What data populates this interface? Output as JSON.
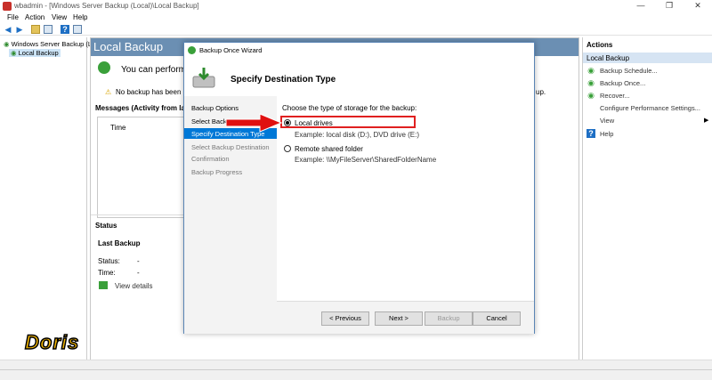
{
  "window": {
    "title": "wbadmin - [Windows Server Backup (Local)\\Local Backup]",
    "min": "—",
    "max": "❐",
    "close": "✕"
  },
  "menu": [
    "File",
    "Action",
    "View",
    "Help"
  ],
  "tree": {
    "root": "Windows Server Backup (L",
    "child": "Local Backup"
  },
  "center": {
    "title": "Local Backup",
    "perform_text": "You can perform",
    "warning_text": "No backup has been c",
    "warning_tail": "up.",
    "messages_label": "Messages (Activity from last w",
    "time_col": "Time",
    "status_label": "Status",
    "last_backup_label": "Last Backup",
    "status_key": "Status:",
    "status_val": "-",
    "time_key": "Time:",
    "time_val": "-",
    "view_details": "View details"
  },
  "actions": {
    "header": "Actions",
    "section": "Local Backup",
    "items": [
      "Backup Schedule...",
      "Backup Once...",
      "Recover...",
      "Configure Performance Settings...",
      "View",
      "Help"
    ]
  },
  "dialog": {
    "title": "Backup Once Wizard",
    "heading": "Specify Destination Type",
    "steps": [
      "Backup Options",
      "Select Backu",
      "Specify Destination Type",
      "Select Backup Destination",
      "Confirmation",
      "Backup Progress"
    ],
    "instruction": "Choose the type of storage for the backup:",
    "option1_label": "Local drives",
    "option1_example": "Example: local disk (D:), DVD drive (E:)",
    "option2_label": "Remote shared folder",
    "option2_example": "Example: \\\\MyFileServer\\SharedFolderName",
    "buttons": {
      "previous": "< Previous",
      "next": "Next >",
      "backup": "Backup",
      "cancel": "Cancel"
    }
  },
  "watermark": "Doris",
  "colors": {
    "accent": "#0078d7",
    "header": "#6b8fb3",
    "highlight": "#e02020",
    "arrow": "#e01010"
  }
}
